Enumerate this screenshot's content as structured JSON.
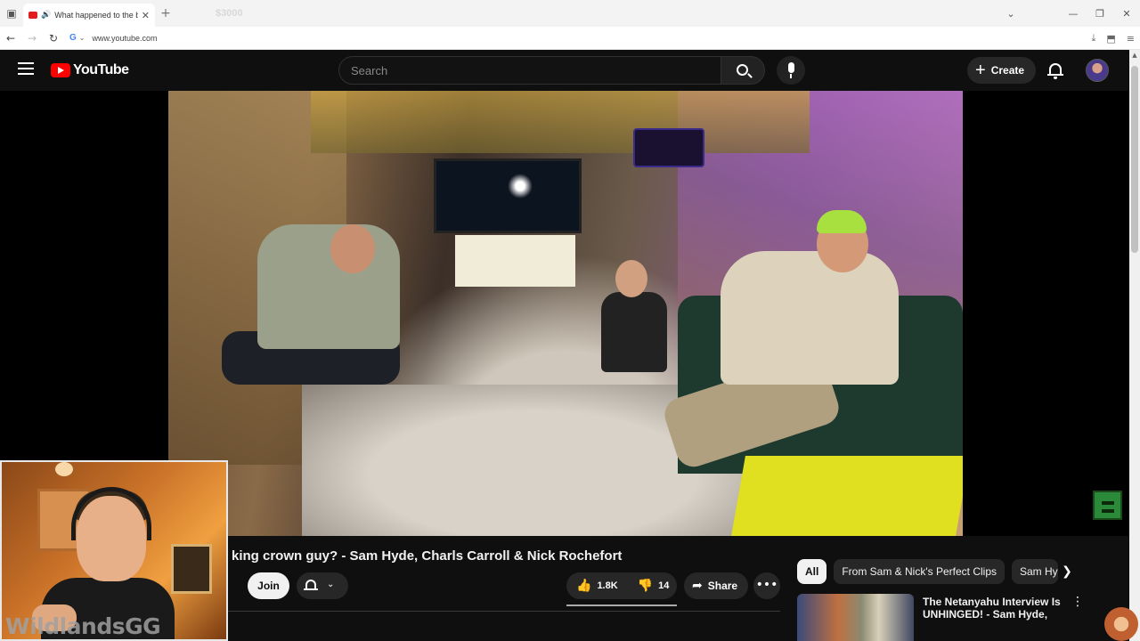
{
  "browser": {
    "tab_title": "What happened to the bur",
    "ghost_tab_text": "$3000",
    "url": "www.youtube.com",
    "google_badge": "G"
  },
  "youtube": {
    "logo_text": "YouTube",
    "search_placeholder": "Search",
    "create_label": "Create"
  },
  "video": {
    "title": "r king crown guy? - Sam Hyde, Charls Carroll & Nick Rochefort",
    "join_label": "Join",
    "likes": "1.8K",
    "dislikes": "14",
    "share_label": "Share"
  },
  "chips": [
    {
      "label": "All",
      "active": true
    },
    {
      "label": "From Sam & Nick's Perfect Clips",
      "active": false
    },
    {
      "label": "Sam Hyd",
      "active": false
    }
  ],
  "recommendation": {
    "title": "The Netanyahu Interview Is UNHINGED! - Sam Hyde, Charl"
  },
  "webcam": {
    "watermark": "WildlandsGG"
  },
  "colors": {
    "youtube_red": "#ff0000",
    "background": "#0f0f0f",
    "chip_bg": "#272727"
  }
}
